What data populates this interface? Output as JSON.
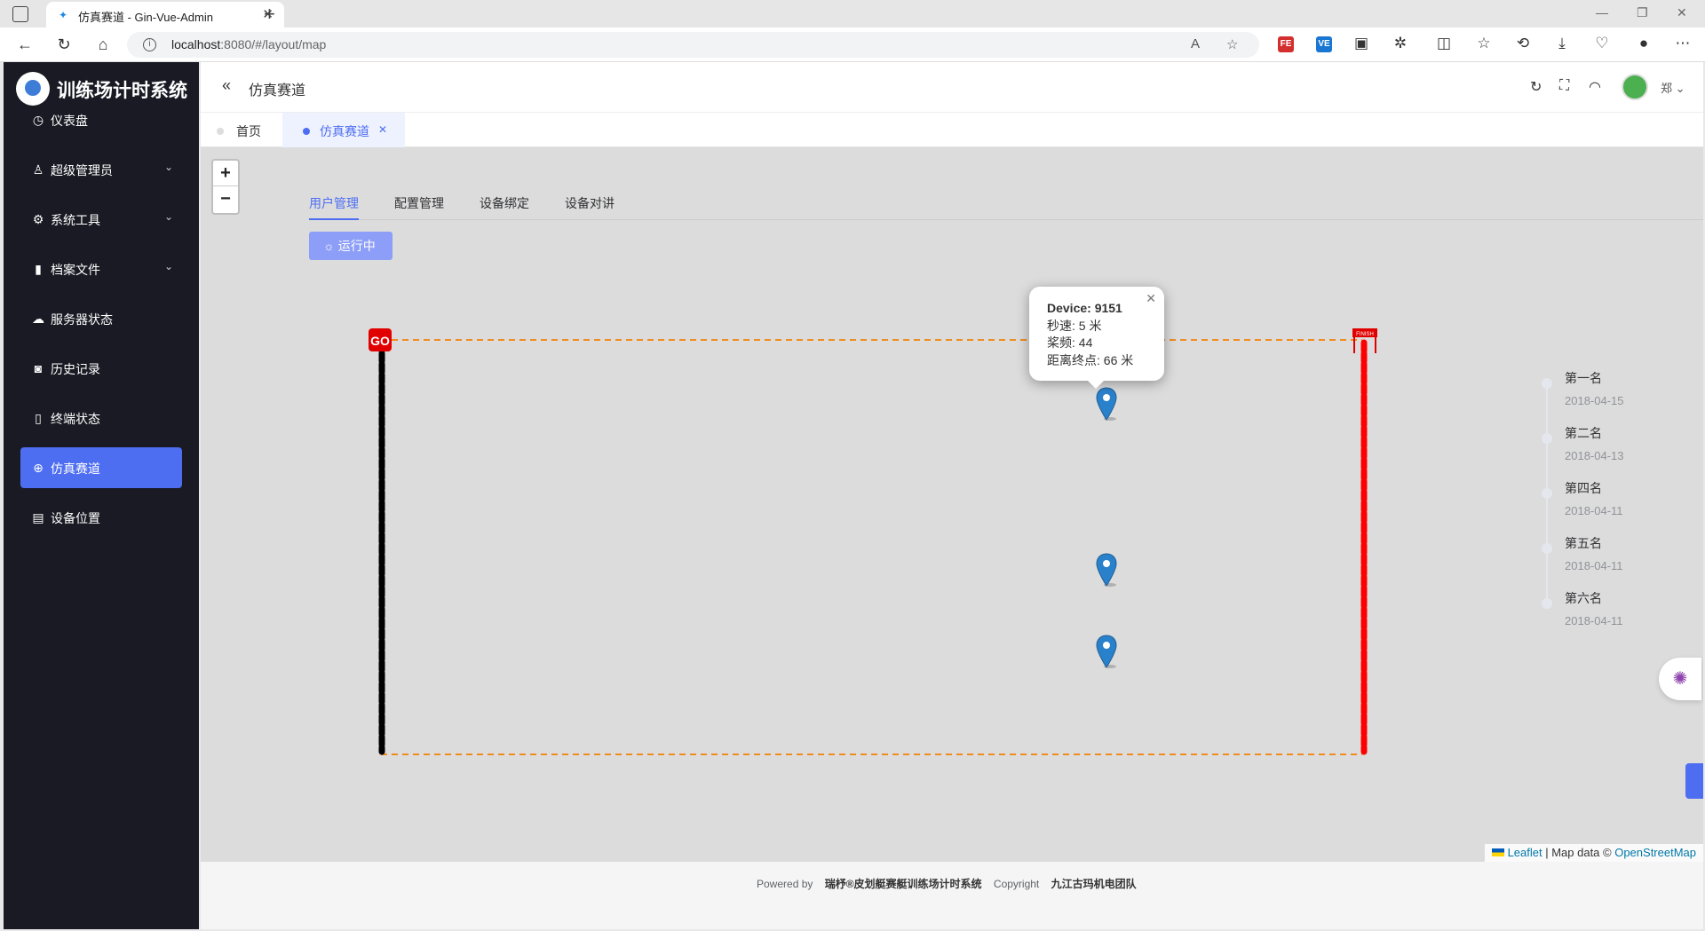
{
  "browser": {
    "tab_title": "仿真赛道 - Gin-Vue-Admin",
    "url_host": "localhost",
    "url_rest": ":8080/#/layout/map"
  },
  "sidebar": {
    "app_title": "训练场计时系统",
    "items": [
      {
        "label": "仪表盘",
        "icon": "dashboard-icon"
      },
      {
        "label": "超级管理员",
        "icon": "user-icon",
        "expandable": true
      },
      {
        "label": "系统工具",
        "icon": "gear-icon",
        "expandable": true
      },
      {
        "label": "档案文件",
        "icon": "archive-icon",
        "expandable": true
      },
      {
        "label": "服务器状态",
        "icon": "cloud-icon"
      },
      {
        "label": "历史记录",
        "icon": "camera-icon"
      },
      {
        "label": "终端状态",
        "icon": "phone-icon"
      },
      {
        "label": "仿真赛道",
        "icon": "target-icon",
        "active": true
      },
      {
        "label": "设备位置",
        "icon": "save-icon"
      }
    ]
  },
  "header": {
    "page_title": "仿真赛道",
    "user_name": "郑"
  },
  "view_tabs": [
    {
      "label": "首页"
    },
    {
      "label": "仿真赛道",
      "active": true
    }
  ],
  "sub_tabs": [
    {
      "label": "用户管理",
      "active": true
    },
    {
      "label": "配置管理"
    },
    {
      "label": "设备绑定"
    },
    {
      "label": "设备对讲"
    }
  ],
  "running_button": "运行中",
  "map": {
    "zoom_in": "+",
    "zoom_out": "−",
    "start_label": "GO",
    "finish_label": "FINISH",
    "popup": {
      "title": "Device: 9151",
      "speed": "秒速: 5 米",
      "stroke_rate": "桨频: 44",
      "distance": "距离终点: 66 米"
    },
    "attribution": {
      "leaflet": "Leaflet",
      "sep": " | Map data © ",
      "osm": "OpenStreetMap"
    }
  },
  "ranking": [
    {
      "name": "第一名",
      "date": "2018-04-15"
    },
    {
      "name": "第二名",
      "date": "2018-04-13"
    },
    {
      "name": "第四名",
      "date": "2018-04-11"
    },
    {
      "name": "第五名",
      "date": "2018-04-11"
    },
    {
      "name": "第六名",
      "date": "2018-04-11"
    }
  ],
  "footer": {
    "powered_by": "Powered by",
    "product": "瑞杼®皮划艇赛艇训练场计时系统",
    "copyright": "Copyright",
    "team": "九江古玛机电团队"
  },
  "colors": {
    "accent": "#4e6ef2",
    "sidebar_bg": "#191a23",
    "start_line": "#000000",
    "finish_line": "#ff0000",
    "lane_line": "#f08c1e",
    "marker": "#2a81cb"
  }
}
